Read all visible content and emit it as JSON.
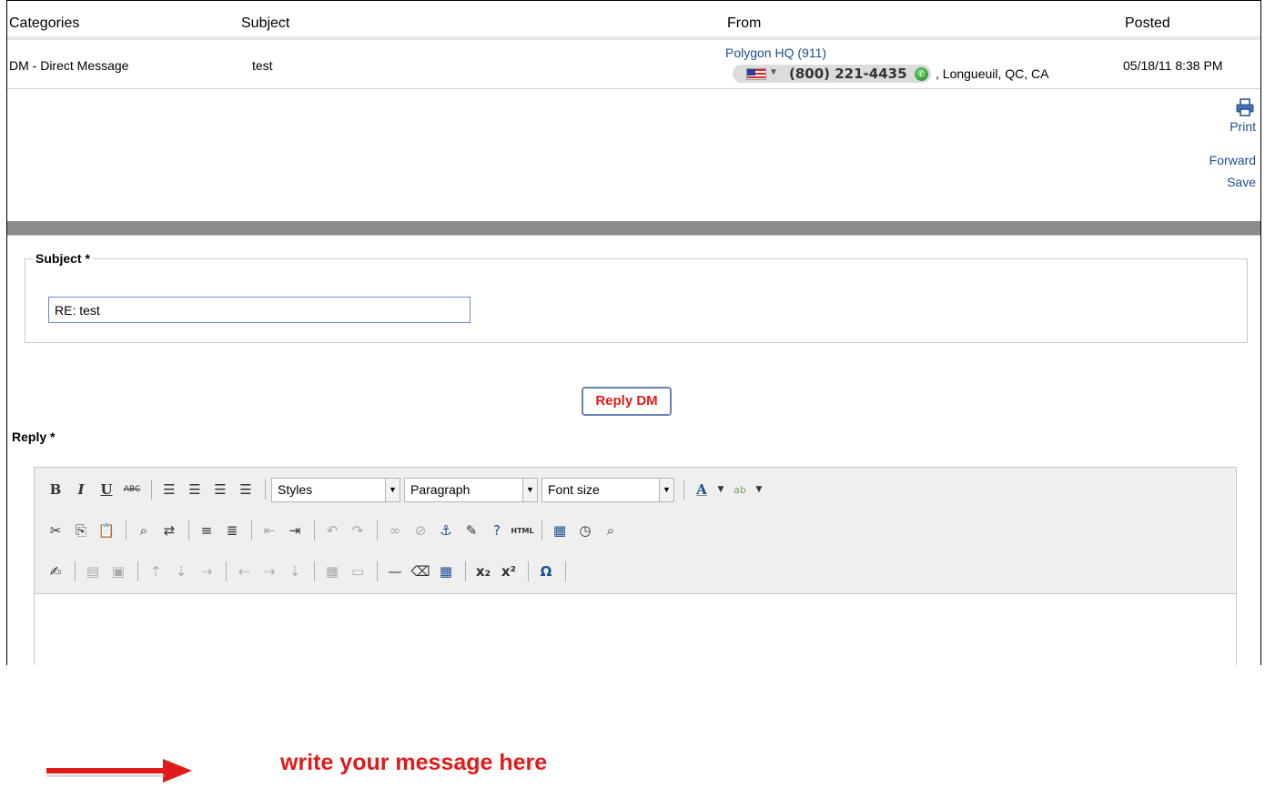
{
  "table": {
    "headers": [
      "Categories",
      "Subject",
      "From",
      "Posted"
    ],
    "row": {
      "category": "DM - Direct Message",
      "subject": "test",
      "from_name": "Polygon HQ (911)",
      "phone": "(800) 221-4435",
      "location": ", Longueuil,  QC, CA",
      "posted": "05/18/11 8:38 PM"
    }
  },
  "actions": {
    "print": "Print",
    "forward": "Forward",
    "save": "Save"
  },
  "form": {
    "subject_legend": "Subject *",
    "subject_value": "RE: test",
    "reply_button": "Reply DM",
    "reply_label": "Reply *"
  },
  "editor": {
    "styles": "Styles",
    "paragraph": "Paragraph",
    "font_size": "Font size",
    "placeholder_hint": "write your message here"
  },
  "colors": {
    "link": "#1d4f91",
    "accent_red": "#e01b1b",
    "divider": "#8c8c8c"
  }
}
